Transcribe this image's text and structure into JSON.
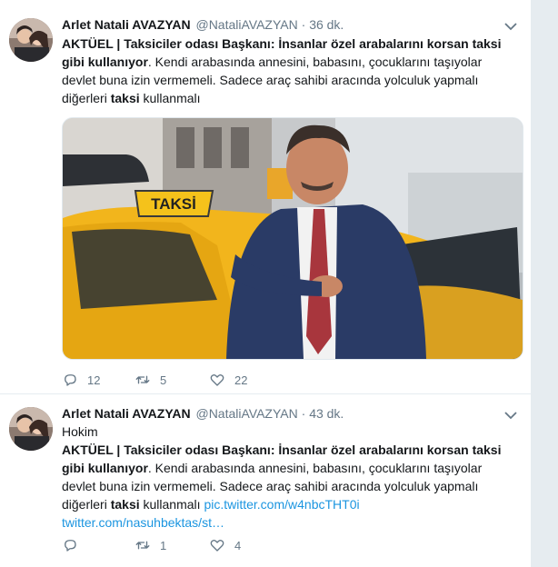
{
  "tweets": [
    {
      "fullname": "Arlet Natali AVAZYAN",
      "username": "@NataliAVAZYAN",
      "separator": "·",
      "time": "36 dk.",
      "reply_line": "",
      "bold_lead": "AKTÜEL | Taksiciler odası Başkanı: İnsanlar özel arabalarını korsan taksi gibi kullanıyor",
      "body": ". Kendi arabasında annesini, babasını, çocuklarını taşıyolar devlet buna izin vermemeli. Sadece araç sahibi aracında yolculuk yapmalı diğerleri ",
      "bold_tail": "taksi",
      "body_end": " kullanmalı",
      "media_sign": "TAKSİ",
      "replies": "12",
      "retweets": "5",
      "likes": "22"
    },
    {
      "fullname": "Arlet Natali AVAZYAN",
      "username": "@NataliAVAZYAN",
      "separator": "·",
      "time": "43 dk.",
      "reply_line": "Hokim",
      "bold_lead": "AKTÜEL | Taksiciler odası Başkanı: İnsanlar özel arabalarını korsan taksi gibi kullanıyor",
      "body": ". Kendi arabasında annesini, babasını, çocuklarını taşıyolar devlet buna izin vermemeli. Sadece araç sahibi aracında yolculuk yapmalı diğerleri ",
      "bold_tail": "taksi",
      "body_end": " kullanmalı ",
      "link1": "pic.twitter.com/w4nbcTHT0i",
      "link2": "twitter.com/nasuhbektas/st…",
      "replies": "",
      "retweets": "1",
      "likes": "4"
    }
  ],
  "icons": {
    "reply": "reply-icon",
    "retweet": "retweet-icon",
    "like": "heart-icon",
    "caret": "chevron-down-icon"
  },
  "colors": {
    "link": "#1b95e0",
    "muted": "#657786",
    "taxi_yellow": "#f2b51c"
  }
}
